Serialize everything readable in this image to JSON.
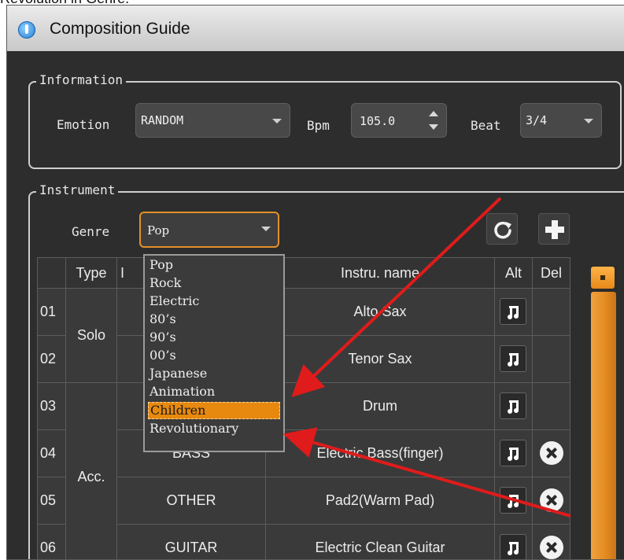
{
  "caption": "Revolution in Genre.",
  "window": {
    "title": "Composition Guide"
  },
  "information": {
    "label": "Information",
    "emotion_label": "Emotion",
    "emotion_value": "RANDOM",
    "bpm_label": "Bpm",
    "bpm_value": "105.0",
    "beat_label": "Beat",
    "beat_value": "3/4"
  },
  "instrument": {
    "label": "Instrument",
    "genre_label": "Genre",
    "genre_value": "Pop",
    "refresh_icon": "refresh-icon",
    "add_icon": "plus-icon"
  },
  "genre_options": [
    "Pop",
    "Rock",
    "Electric",
    "80’s",
    "90’s",
    "00’s",
    "Japanese",
    "Animation",
    "Children",
    "Revolutionary"
  ],
  "genre_highlighted": "Children",
  "table": {
    "headers": {
      "type": "Type",
      "instrument_type_partial": "I",
      "name": "Instru. name",
      "alt": "Alt",
      "del": "Del"
    },
    "groups": [
      {
        "label": "Solo"
      },
      {
        "label": "Acc."
      }
    ],
    "rows": [
      {
        "num": "01",
        "category": "",
        "name": "Alto Sax",
        "has_alt": true,
        "has_del": false
      },
      {
        "num": "02",
        "category": "",
        "name": "Tenor Sax",
        "has_alt": true,
        "has_del": false
      },
      {
        "num": "03",
        "category": "",
        "name": "Drum",
        "has_alt": true,
        "has_del": false
      },
      {
        "num": "04",
        "category": "BASS",
        "name": "Electric Bass(finger)",
        "has_alt": true,
        "has_del": true
      },
      {
        "num": "05",
        "category": "OTHER",
        "name": "Pad2(Warm Pad)",
        "has_alt": true,
        "has_del": true
      },
      {
        "num": "06",
        "category": "GUITAR",
        "name": "Electric Clean Guitar",
        "has_alt": true,
        "has_del": true
      }
    ]
  },
  "colors": {
    "accent": "#e8890f",
    "annotation_arrow": "#e01b1b",
    "panel_bg": "#2d2d2d"
  }
}
